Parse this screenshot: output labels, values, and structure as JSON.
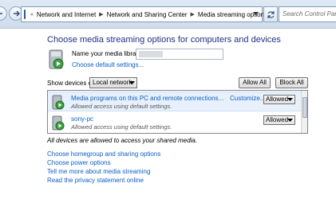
{
  "address_bar": {
    "crumbs": [
      "Network and Internet",
      "Network and Sharing Center",
      "Media streaming options"
    ],
    "search_placeholder": "Search Control Panel"
  },
  "page": {
    "title": "Choose media streaming options for computers and devices"
  },
  "library": {
    "label": "Name your media library:",
    "default_link": "Choose default settings..."
  },
  "devices": {
    "show_label": "Show devices on:",
    "network_select": "Local network",
    "allow_all": "Allow All",
    "block_all": "Block All",
    "items": [
      {
        "name": "Media programs on this PC and remote connections...",
        "status": "Allowed access using default settings.",
        "customize": "Customize...",
        "permission": "Allowed"
      },
      {
        "name": "sony-pc",
        "status": "Allowed access using default settings.",
        "permission": "Allowed"
      }
    ]
  },
  "note": "All devices are allowed to access your shared media.",
  "links": [
    "Choose homegroup and sharing options",
    "Choose power options",
    "Tell me more about media streaming",
    "Read the privacy statement online"
  ]
}
